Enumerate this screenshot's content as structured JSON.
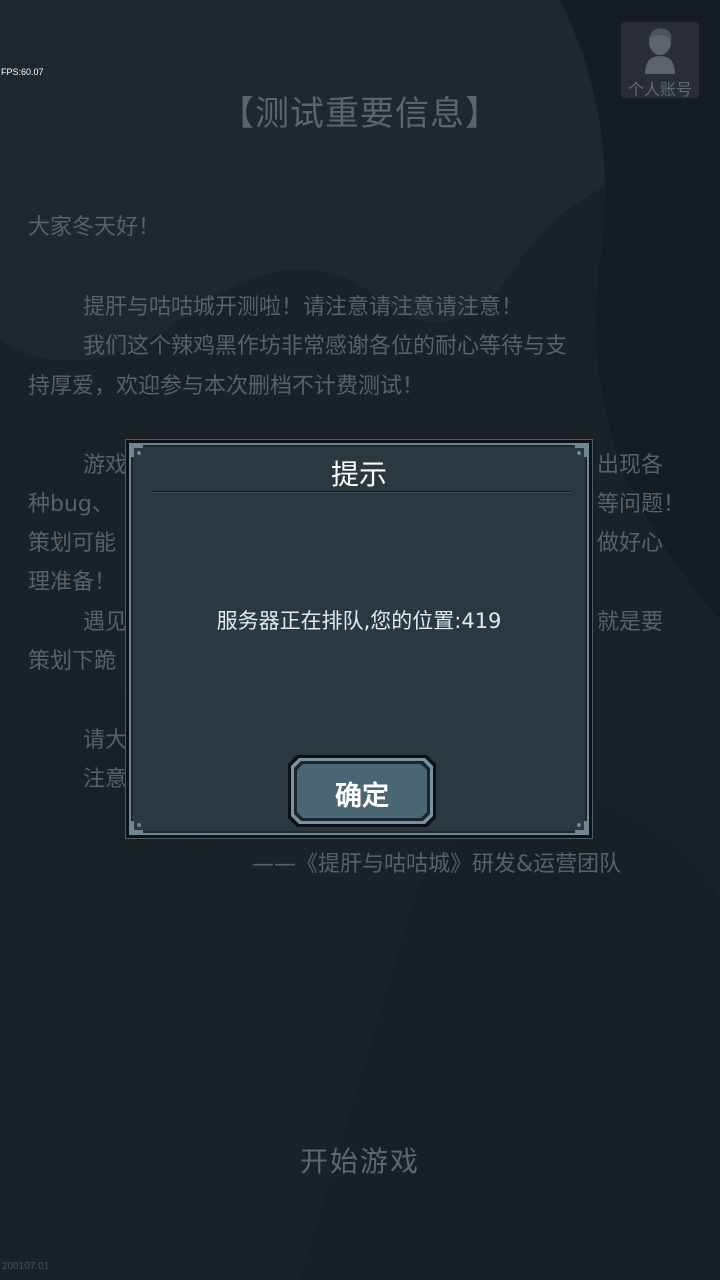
{
  "debug": {
    "fps": "FPS:60.07",
    "version": "200107.01"
  },
  "account": {
    "label": "个人账号",
    "icon": "user-silhouette-icon"
  },
  "notice": {
    "title": "【测试重要信息】",
    "lines": [
      "大家冬天好！",
      "提肝与咕咕城开测啦！请注意请注意请注意！",
      "我们这个辣鸡黑作坊非常感谢各位的耐心等待与支",
      "持厚爱，欢迎参与本次删档不计费测试！",
      "游戏",
      "出现各",
      "种bug、",
      "等问题！",
      "策划可能",
      "做好心",
      "理准备！",
      "遇见",
      "就是要",
      "策划下跪",
      "请大",
      "注意"
    ],
    "signature": "——《提肝与咕咕城》研发&运营团队"
  },
  "start_button": {
    "label": "开始游戏"
  },
  "dialog": {
    "title": "提示",
    "message": "服务器正在排队,您的位置:419",
    "confirm_label": "确定"
  }
}
